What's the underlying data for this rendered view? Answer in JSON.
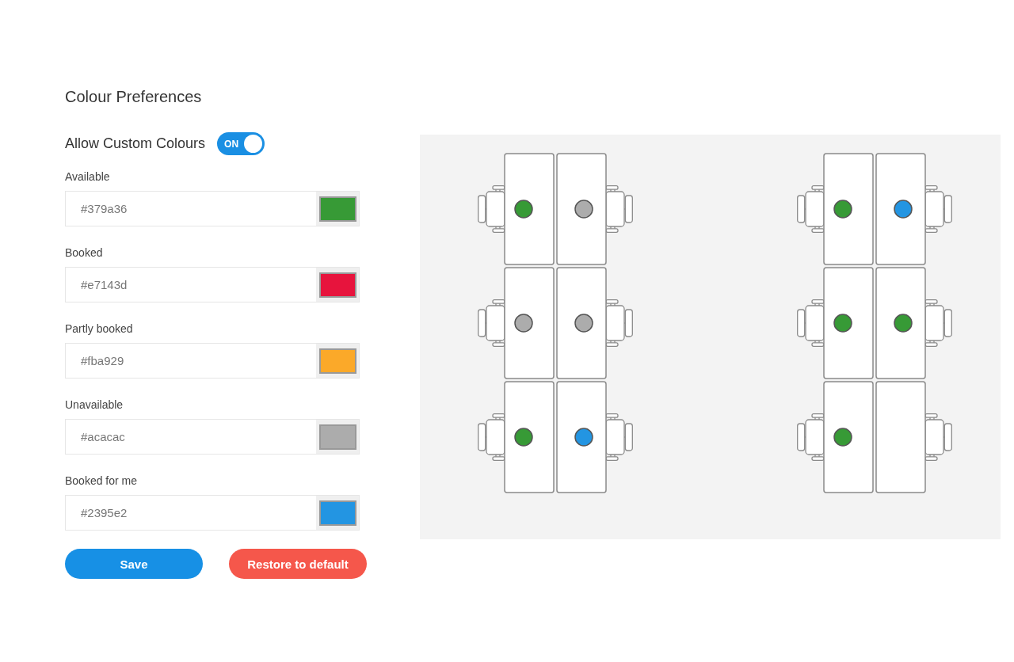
{
  "title": "Colour Preferences",
  "custom_colours": {
    "label": "Allow Custom Colours",
    "on": true,
    "state_text": "ON"
  },
  "colours": [
    {
      "label": "Available",
      "value": "#379a36",
      "color": "#379a36"
    },
    {
      "label": "Booked",
      "value": "#e7143d",
      "color": "#e7143d"
    },
    {
      "label": "Partly booked",
      "value": "#fba929",
      "color": "#fba929"
    },
    {
      "label": "Unavailable",
      "value": "#acacac",
      "color": "#acacac"
    },
    {
      "label": "Booked for me",
      "value": "#2395e2",
      "color": "#2395e2"
    }
  ],
  "buttons": [
    {
      "label": "Save",
      "kind": "primary"
    },
    {
      "label": "Restore to default",
      "kind": "danger"
    }
  ],
  "floor_plan": {
    "clusters": [
      {
        "rows": [
          {
            "desks": [
              {
                "has_marker": true,
                "color": "#379a36"
              },
              {
                "has_marker": true,
                "color": "#acacac"
              }
            ]
          },
          {
            "desks": [
              {
                "has_marker": true,
                "color": "#acacac"
              },
              {
                "has_marker": true,
                "color": "#acacac"
              }
            ]
          },
          {
            "desks": [
              {
                "has_marker": true,
                "color": "#379a36"
              },
              {
                "has_marker": true,
                "color": "#2395e2"
              }
            ]
          }
        ]
      },
      {
        "rows": [
          {
            "desks": [
              {
                "has_marker": true,
                "color": "#379a36"
              },
              {
                "has_marker": true,
                "color": "#2395e2"
              }
            ]
          },
          {
            "desks": [
              {
                "has_marker": true,
                "color": "#379a36"
              },
              {
                "has_marker": true,
                "color": "#379a36"
              }
            ]
          },
          {
            "desks": [
              {
                "has_marker": true,
                "color": "#379a36"
              },
              {
                "has_marker": false
              }
            ]
          }
        ]
      }
    ]
  }
}
